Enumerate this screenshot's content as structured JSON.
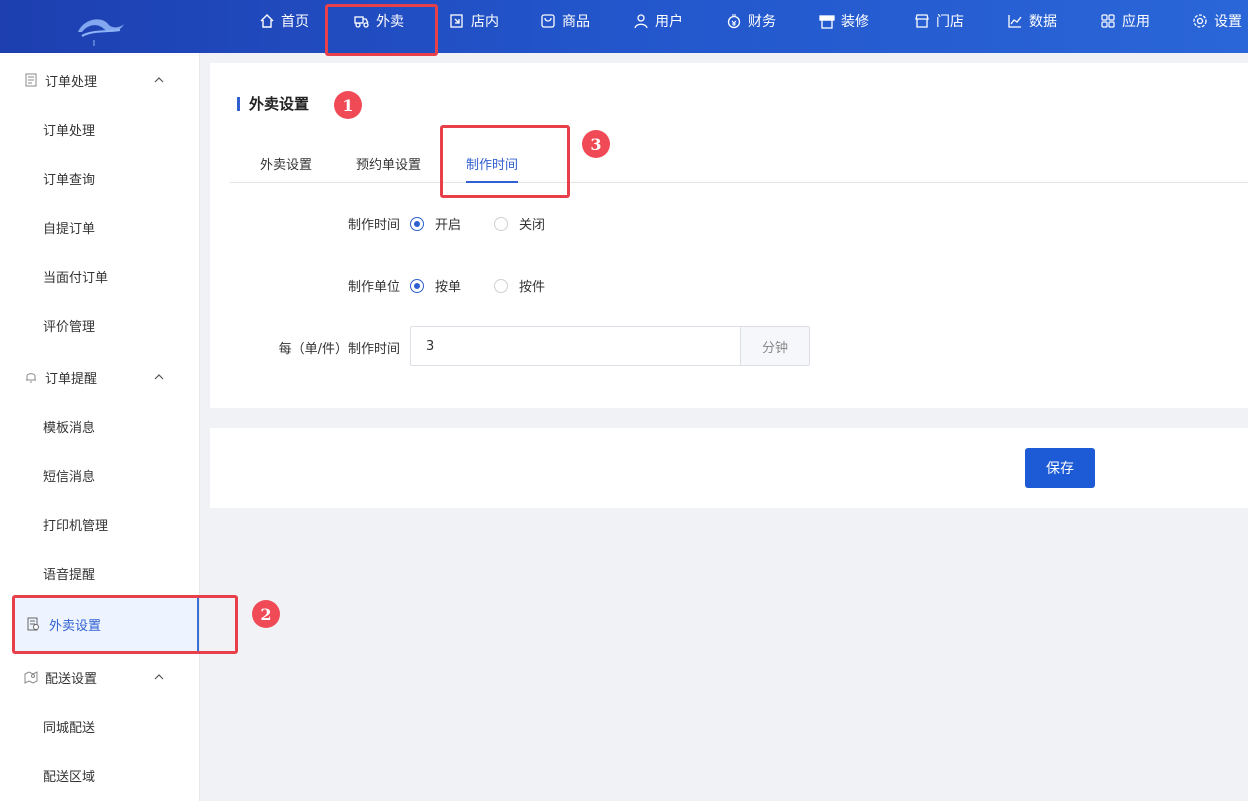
{
  "nav": {
    "items": [
      {
        "label": "首页",
        "icon": "home-icon"
      },
      {
        "label": "外卖",
        "icon": "delivery-icon"
      },
      {
        "label": "店内",
        "icon": "store-in-icon"
      },
      {
        "label": "商品",
        "icon": "goods-icon"
      },
      {
        "label": "用户",
        "icon": "user-icon"
      },
      {
        "label": "财务",
        "icon": "money-icon"
      },
      {
        "label": "装修",
        "icon": "decorate-icon"
      },
      {
        "label": "门店",
        "icon": "shop-icon"
      },
      {
        "label": "数据",
        "icon": "chart-icon"
      },
      {
        "label": "应用",
        "icon": "apps-icon"
      },
      {
        "label": "设置",
        "icon": "gear-icon"
      }
    ],
    "active": "外卖"
  },
  "sidebar": {
    "groups": [
      {
        "title": "订单处理",
        "icon": "order-doc-icon",
        "items": [
          "订单处理",
          "订单查询",
          "自提订单",
          "当面付订单",
          "评价管理"
        ]
      },
      {
        "title": "订单提醒",
        "icon": "bell-icon",
        "items": [
          "模板消息",
          "短信消息",
          "打印机管理",
          "语音提醒"
        ]
      },
      {
        "title": "外卖设置",
        "icon": "settings-doc-icon",
        "items": []
      },
      {
        "title": "配送设置",
        "icon": "map-icon",
        "items": [
          "同城配送",
          "配送区域"
        ]
      }
    ],
    "active_item": "外卖设置"
  },
  "main": {
    "title": "外卖设置",
    "tabs": [
      "外卖设置",
      "预约单设置",
      "制作时间"
    ],
    "active_tab": "制作时间",
    "form": {
      "make_time": {
        "label": "制作时间",
        "options": [
          "开启",
          "关闭"
        ],
        "selected": "开启"
      },
      "make_unit": {
        "label": "制作单位",
        "options": [
          "按单",
          "按件"
        ],
        "selected": "按单"
      },
      "per_time": {
        "label": "每（单/件）制作时间",
        "value": "3",
        "suffix": "分钟"
      }
    },
    "save_label": "保存"
  },
  "annotations": {
    "badges": [
      "1",
      "2",
      "3"
    ],
    "color": "#e8404a"
  },
  "colors": {
    "primary": "#2f5fd0",
    "topbar": "#2356cc",
    "button": "#1d5bd6"
  }
}
